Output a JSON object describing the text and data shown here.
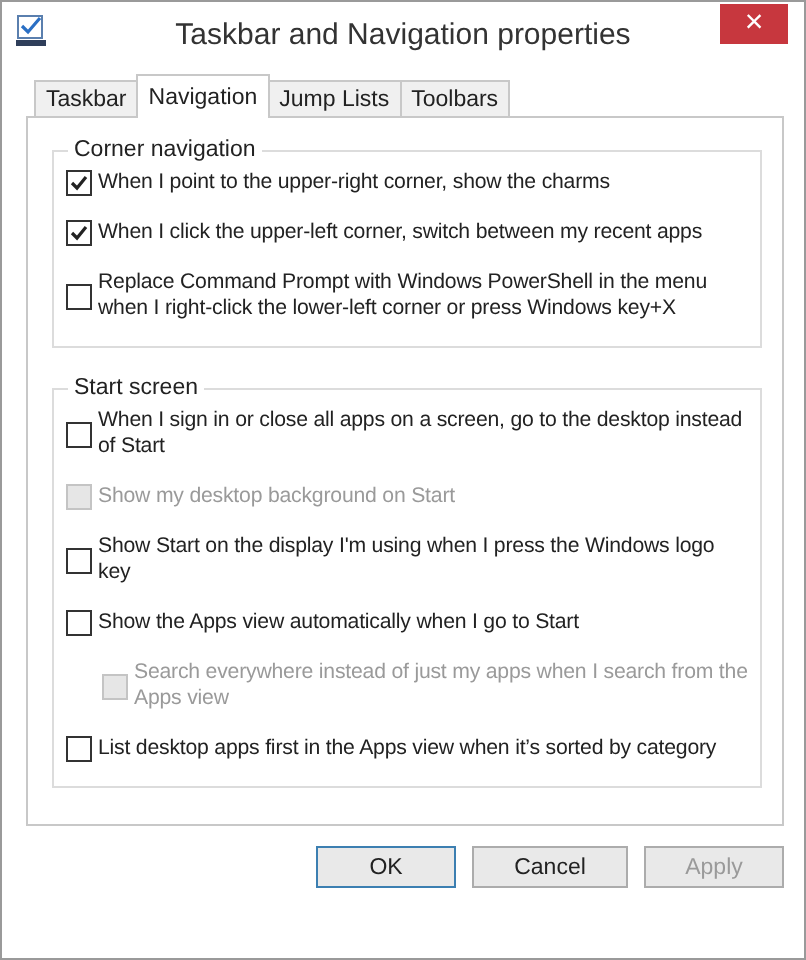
{
  "window": {
    "title": "Taskbar and Navigation properties",
    "close": "×"
  },
  "tabs": [
    {
      "label": "Taskbar",
      "selected": false
    },
    {
      "label": "Navigation",
      "selected": true
    },
    {
      "label": "Jump Lists",
      "selected": false
    },
    {
      "label": "Toolbars",
      "selected": false
    }
  ],
  "groups": [
    {
      "title": "Corner navigation",
      "options": [
        {
          "label": "When I point to the upper-right corner, show the charms",
          "checked": true,
          "disabled": false
        },
        {
          "label": "When I click the upper-left corner, switch between my recent apps",
          "checked": true,
          "disabled": false
        },
        {
          "label": "Replace Command Prompt with Windows PowerShell in the menu when I right-click the lower-left corner or press Windows key+X",
          "checked": false,
          "disabled": false
        }
      ]
    },
    {
      "title": "Start screen",
      "options": [
        {
          "label": "When I sign in or close all apps on a screen, go to the desktop instead of Start",
          "checked": false,
          "disabled": false
        },
        {
          "label": "Show my desktop background on Start",
          "checked": false,
          "disabled": true
        },
        {
          "label": "Show Start on the display I'm using when I press the Windows logo key",
          "checked": false,
          "disabled": false
        },
        {
          "label": "Show the Apps view automatically when I go to Start",
          "checked": false,
          "disabled": false,
          "children": [
            {
              "label": "Search everywhere instead of just my apps when I search from the Apps view",
              "checked": false,
              "disabled": true
            }
          ]
        },
        {
          "label": "List desktop apps first in the Apps view when it’s sorted by category",
          "checked": false,
          "disabled": false
        }
      ]
    }
  ],
  "buttons": [
    {
      "label": "OK",
      "default": true,
      "disabled": false
    },
    {
      "label": "Cancel",
      "default": false,
      "disabled": false
    },
    {
      "label": "Apply",
      "default": false,
      "disabled": true
    }
  ]
}
